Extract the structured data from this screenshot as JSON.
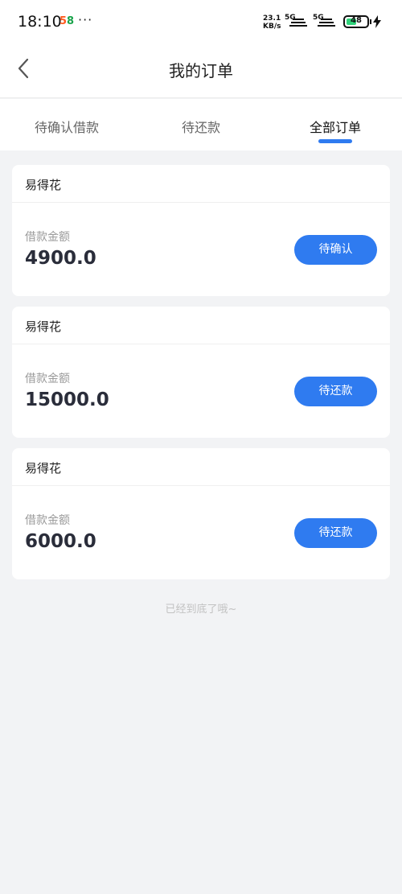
{
  "status_bar": {
    "time": "18:10",
    "app_badge_part1": "5",
    "app_badge_part2": "8",
    "dots": "···",
    "speed_value": "23.1",
    "speed_unit": "KB/s",
    "sig1_label": "5G",
    "sig2_label": "5G",
    "battery": "48",
    "battery_level": 0.48
  },
  "header": {
    "title": "我的订单"
  },
  "tabs": [
    {
      "label": "待确认借款",
      "active": false
    },
    {
      "label": "待还款",
      "active": false
    },
    {
      "label": "全部订单",
      "active": true
    }
  ],
  "orders": [
    {
      "lender": "易得花",
      "amount_label": "借款金额",
      "amount": "4900.0",
      "status_button": "待确认"
    },
    {
      "lender": "易得花",
      "amount_label": "借款金额",
      "amount": "15000.0",
      "status_button": "待还款"
    },
    {
      "lender": "易得花",
      "amount_label": "借款金额",
      "amount": "6000.0",
      "status_button": "待还款"
    }
  ],
  "footer_note": "已经到底了哦~",
  "colors": {
    "accent": "#2f7bf0",
    "background": "#f2f3f5",
    "battery": "#2fd37a"
  }
}
